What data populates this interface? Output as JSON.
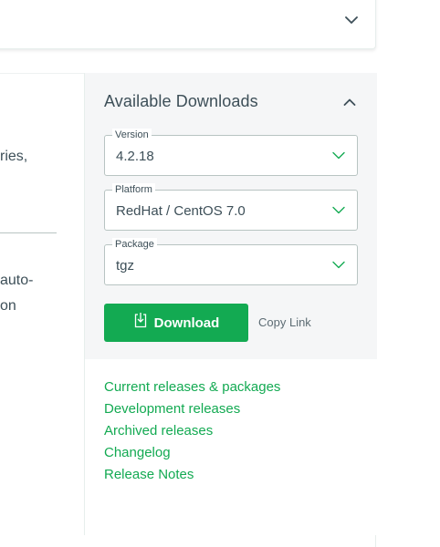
{
  "left_column": {
    "text_line_1": "ries,",
    "text_line_2": "auto-",
    "text_line_3": "on"
  },
  "downloads": {
    "title": "Available Downloads",
    "fields": [
      {
        "label": "Version",
        "value": "4.2.18"
      },
      {
        "label": "Platform",
        "value": "RedHat / CentOS 7.0"
      },
      {
        "label": "Package",
        "value": "tgz"
      }
    ],
    "download_label": "Download",
    "copy_link_label": "Copy Link"
  },
  "links": [
    "Current releases & packages",
    "Development releases",
    "Archived releases",
    "Changelog",
    "Release Notes"
  ],
  "colors": {
    "accent": "#13aa52",
    "panel_bg": "#f5f6f7",
    "text": "#3d4f58"
  },
  "icons": {
    "top_toggle": "chevron-down-icon",
    "panel_toggle": "chevron-up-icon",
    "download": "download-icon"
  }
}
